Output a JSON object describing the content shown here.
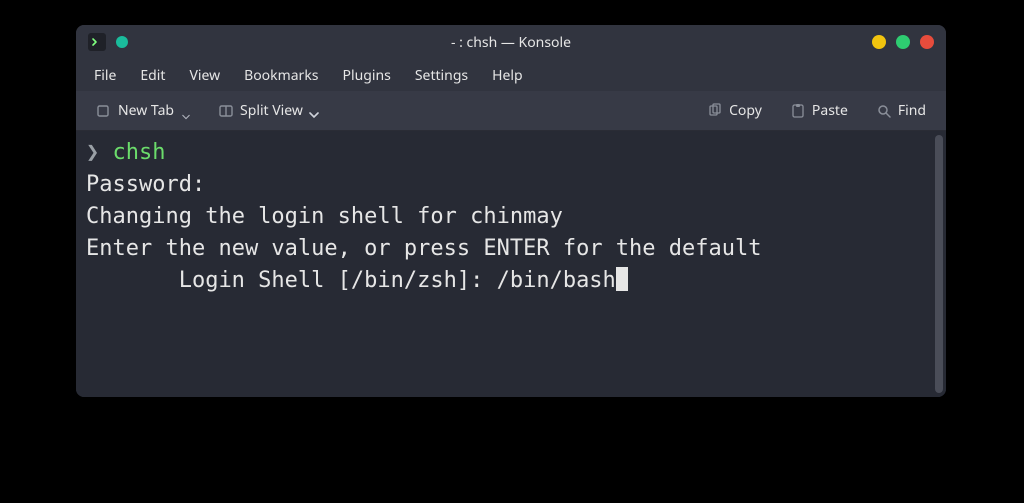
{
  "window": {
    "title": "- : chsh — Konsole"
  },
  "menubar": {
    "items": [
      "File",
      "Edit",
      "View",
      "Bookmarks",
      "Plugins",
      "Settings",
      "Help"
    ]
  },
  "toolbar": {
    "new_tab": "New Tab",
    "split_view": "Split View",
    "copy": "Copy",
    "paste": "Paste",
    "find": "Find"
  },
  "terminal": {
    "prompt_symbol": "❯",
    "command": "chsh",
    "lines": {
      "password": "Password:",
      "changing": "Changing the login shell for chinmay",
      "enter_new": "Enter the new value, or press ENTER for the default",
      "login_shell_label": "Login Shell [/bin/zsh]: ",
      "login_shell_value": "/bin/bash"
    }
  }
}
